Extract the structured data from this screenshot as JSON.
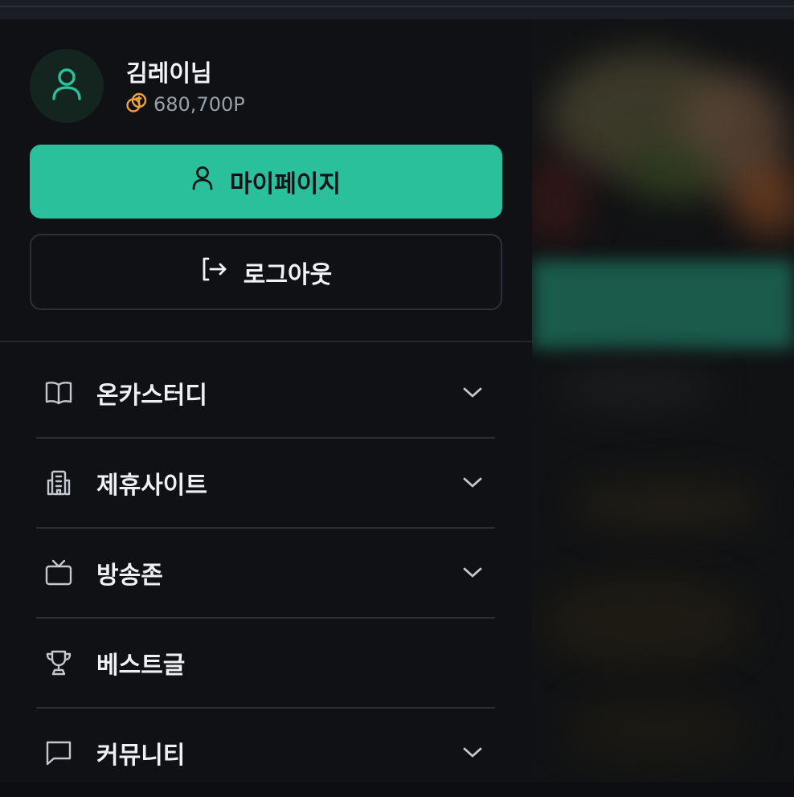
{
  "profile": {
    "name": "김레이님",
    "points": "680,700P"
  },
  "buttons": {
    "mypage_label": "마이페이지",
    "logout_label": "로그아웃"
  },
  "menu": {
    "items": [
      {
        "label": "온카스터디",
        "icon": "book-icon",
        "has_chevron": true
      },
      {
        "label": "제휴사이트",
        "icon": "building-icon",
        "has_chevron": true
      },
      {
        "label": "방송존",
        "icon": "tv-icon",
        "has_chevron": true
      },
      {
        "label": "베스트글",
        "icon": "trophy-icon",
        "has_chevron": false
      },
      {
        "label": "커뮤니티",
        "icon": "chat-bubble-icon",
        "has_chevron": true
      }
    ]
  },
  "colors": {
    "accent": "#2ac09c",
    "avatar_icon": "#2ac09c",
    "coin": "#f0a040",
    "drawer_bg": "#0f1115"
  }
}
